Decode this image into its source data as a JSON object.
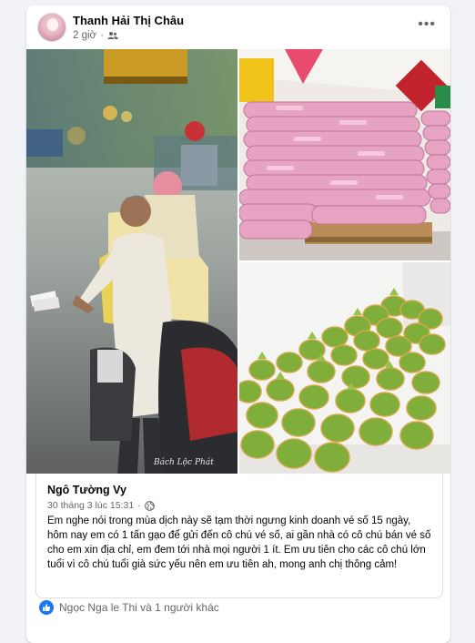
{
  "post": {
    "author": "Thanh Hải Thị Châu",
    "time": "2 giờ",
    "audience_icon": "friends-icon",
    "more_icon": "more-options-icon"
  },
  "photos": {
    "watermark": "Bách Lộc Phát",
    "alt_left": "",
    "alt_top_right": "",
    "alt_bottom_right": ""
  },
  "shared": {
    "author": "Ngô Tường Vy",
    "timestamp": "30 tháng 3 lúc 15:31",
    "body": "Em nghe nói trong mùa dịch này sẽ tạm thời ngưng kinh doanh vé số 15 ngày, hôm nay em có 1 tấn gạo để gửi đến cô chú vé số, ai gần nhà có cô chú bán vé số cho em xin địa chỉ, em đem tới nhà mọi người 1 ít. Em ưu tiên cho các cô chú lớn tuổi vì cô chú tuổi già sức yếu nên em ưu tiên ah, mong anh chị thông cảm!"
  },
  "reactions": {
    "text": "Ngọc Nga le Thi và 1 người khác",
    "icon": "like-icon"
  },
  "colors": {
    "accent": "#1877f2",
    "secondary_text": "#65676b",
    "primary_text": "#050505"
  }
}
